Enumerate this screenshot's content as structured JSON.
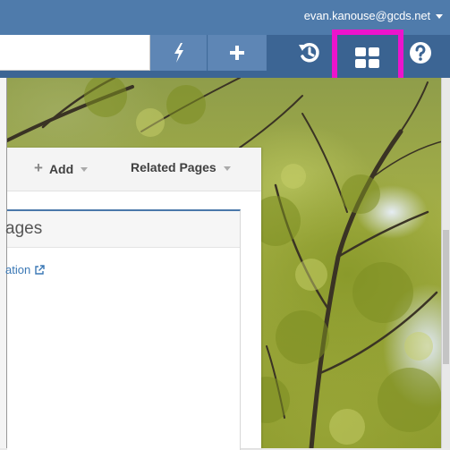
{
  "topbar": {
    "user_email": "evan.kanouse@gcds.net"
  },
  "toolbar": {
    "buttons": [
      {
        "name": "bolt",
        "icon": "lightning-bolt-icon"
      },
      {
        "name": "plus",
        "icon": "plus-icon"
      },
      {
        "name": "history",
        "icon": "history-icon"
      },
      {
        "name": "dashboard",
        "icon": "grid-icon",
        "highlighted": true,
        "highlight_color": "#ec14cc"
      },
      {
        "name": "help",
        "icon": "question-circle-icon"
      }
    ]
  },
  "panel": {
    "add_label": "Add",
    "related_label": "Related Pages",
    "section_title": "ages",
    "link_text": "ation"
  },
  "colors": {
    "topbar_bg": "#4f7bab",
    "toolbar_bg": "#3c6594",
    "link": "#3b78b5",
    "section_border": "#4a78aa"
  }
}
